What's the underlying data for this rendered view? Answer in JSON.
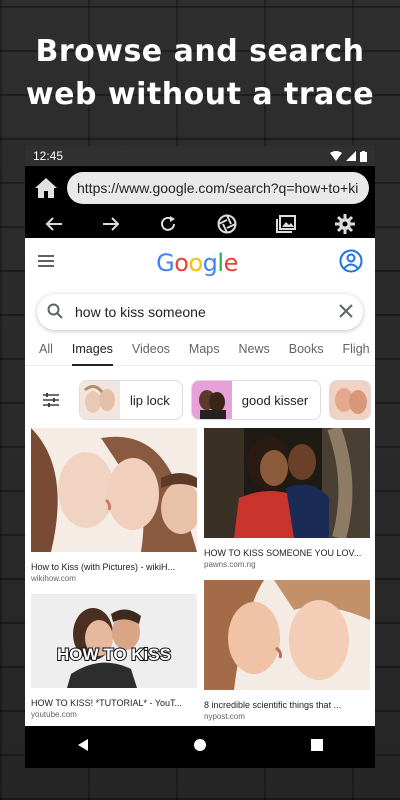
{
  "promo": {
    "line1": "Browse and search",
    "line2": "web without a trace"
  },
  "status": {
    "time": "12:45"
  },
  "browser": {
    "url": "https://www.google.com/search?q=how+to+ki"
  },
  "google": {
    "logo": [
      "G",
      "o",
      "o",
      "g",
      "l",
      "e"
    ],
    "logo_colors": [
      "#4285F4",
      "#EA4335",
      "#FBBC05",
      "#4285F4",
      "#34A853",
      "#EA4335"
    ],
    "query": "how to kiss someone",
    "tabs": [
      "All",
      "Images",
      "Videos",
      "Maps",
      "News",
      "Books",
      "Fligh"
    ],
    "active_tab": "Images",
    "chips": [
      {
        "label": "lip lock"
      },
      {
        "label": "good kisser"
      }
    ],
    "results": [
      {
        "title": "How to Kiss (with Pictures) - wikiH...",
        "source": "wikihow.com"
      },
      {
        "title": "HOW TO KISS SOMEONE YOU LOV...",
        "source": "pawns.com.ng"
      },
      {
        "title": "HOW TO KISS! *TUTORIAL* - YouT...",
        "source": "youtube.com",
        "overlay": "HOW TO KiSS"
      },
      {
        "title": "8 incredible scientific things that ...",
        "source": "nypost.com"
      }
    ]
  },
  "icons": [
    "home-icon",
    "back-arrow-icon",
    "forward-arrow-icon",
    "refresh-icon",
    "aperture-icon",
    "gallery-icon",
    "gear-icon",
    "hamburger-icon",
    "account-icon",
    "search-icon",
    "clear-icon",
    "tune-icon"
  ]
}
